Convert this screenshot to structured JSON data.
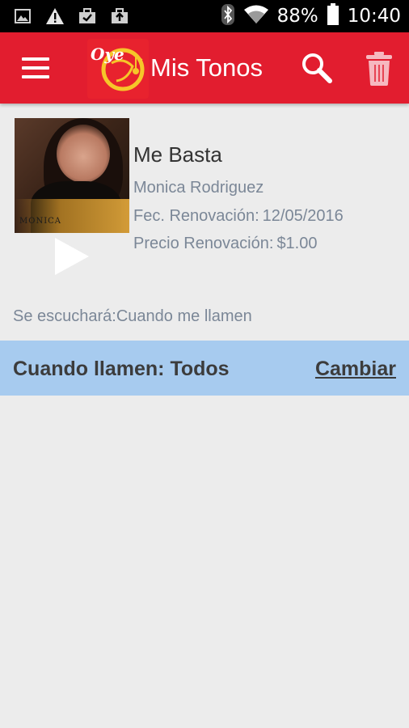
{
  "status_bar": {
    "battery": "88%",
    "time": "10:40",
    "left_icons": [
      "image-icon",
      "warning-icon",
      "briefcase-check-icon",
      "briefcase-upload-icon"
    ],
    "right_icons": [
      "bluetooth-icon",
      "wifi-icon",
      "battery-icon"
    ]
  },
  "app_bar": {
    "title": "Mis Tonos",
    "logo_text": "Oye",
    "colors": {
      "background": "#e21d2f"
    }
  },
  "tone": {
    "title": "Me Basta",
    "artist": "Monica Rodriguez",
    "renewal_date_label": "Fec. Renovación:",
    "renewal_date": "12/05/2016",
    "renewal_price_label": "Precio Renovación:",
    "renewal_price": "$1.00",
    "album_brand": "MONICA"
  },
  "plays_on": {
    "label": "Se escuchará:",
    "value": "Cuando me llamen"
  },
  "callers": {
    "label": "Cuando llamen: Todos",
    "change": "Cambiar",
    "colors": {
      "background": "#a7cbef"
    }
  }
}
